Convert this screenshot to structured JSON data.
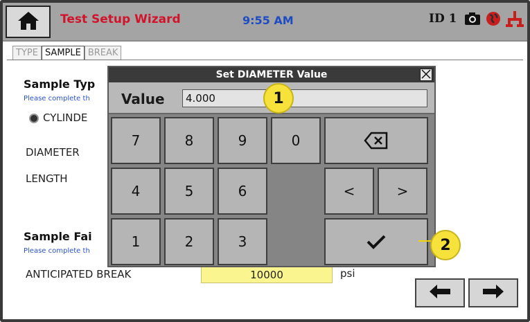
{
  "header": {
    "title": "Test Setup Wizard",
    "time": "9:55 AM",
    "station_id": "ID 1",
    "icons": [
      "home-icon",
      "camera-icon",
      "globe-icon",
      "network-icon"
    ]
  },
  "tabs": [
    {
      "label": "TYPE",
      "active": false
    },
    {
      "label": "SAMPLE",
      "active": true
    },
    {
      "label": "BREAK",
      "active": false
    }
  ],
  "form": {
    "sample_type_title": "Sample Typ",
    "sample_type_hint": "Please complete th",
    "cylinder_label": "CYLINDE",
    "diameter_label": "DIAMETER",
    "length_label": "LENGTH",
    "sample_fail_title": "Sample Fai",
    "sample_fail_hint": "Please complete th",
    "anticipated_break_label": "ANTICIPATED BREAK",
    "anticipated_break_value": "10000",
    "unit": "psi"
  },
  "dialog": {
    "title": "Set DIAMETER Value",
    "value_label": "Value",
    "value": "4.000",
    "keys": {
      "k7": "7",
      "k8": "8",
      "k9": "9",
      "k0": "0",
      "k4": "4",
      "k5": "5",
      "k6": "6",
      "k1": "1",
      "k2": "2",
      "k3": "3",
      "left": "<",
      "right": ">"
    }
  },
  "callouts": {
    "one": "1",
    "two": "2"
  },
  "colors": {
    "title_red": "#d0142c",
    "clock_blue": "#1f4cc2",
    "hint_blue": "#2a52c9",
    "field_yellow": "#fbf590",
    "callout_yellow": "#f6e23a"
  }
}
